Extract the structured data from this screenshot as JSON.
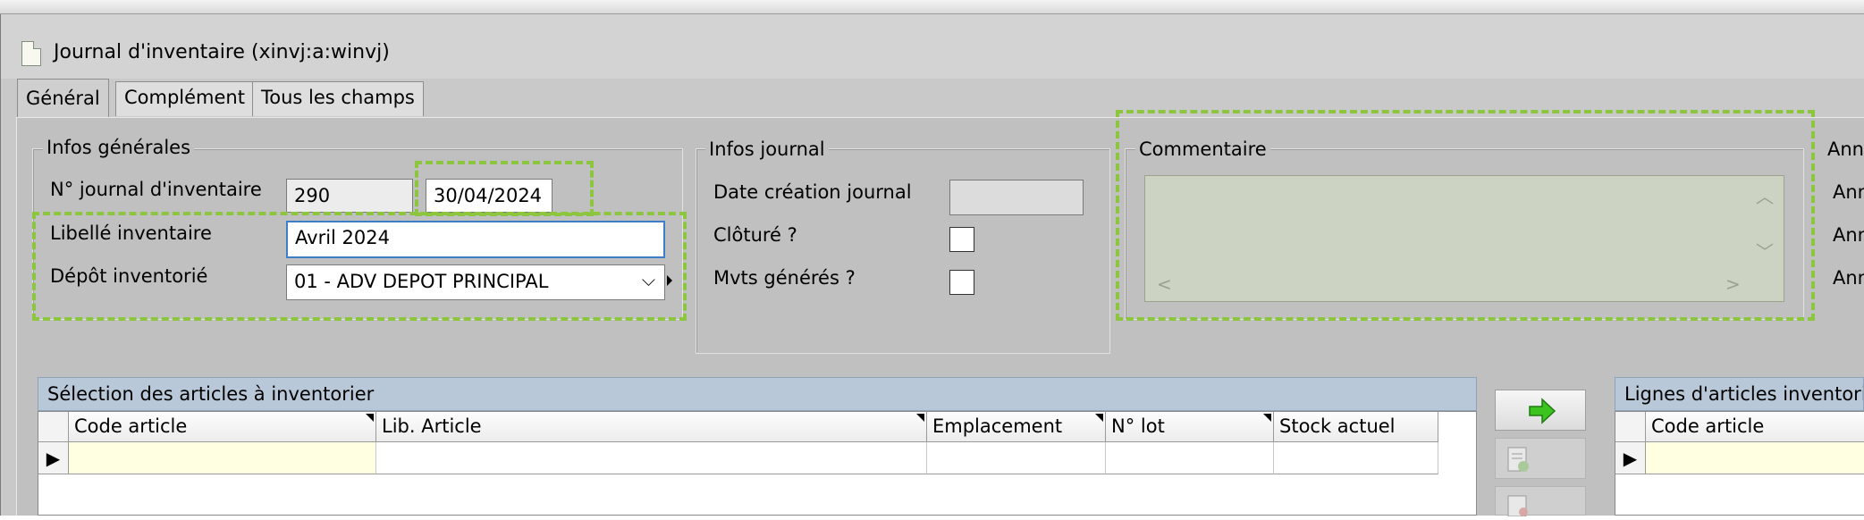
{
  "window": {
    "title": "Journal d'inventaire (xinvj:a:winvj)",
    "icon": "document-icon"
  },
  "tabs": [
    {
      "label": "Général",
      "active": true
    },
    {
      "label": "Complément",
      "active": false
    },
    {
      "label": "Tous les champs",
      "active": false
    }
  ],
  "infos_generales": {
    "title": "Infos générales",
    "journal_number": {
      "label": "N° journal d'inventaire",
      "value": "290",
      "date": "30/04/2024"
    },
    "libelle": {
      "label": "Libellé inventaire",
      "value": "Avril 2024"
    },
    "depot": {
      "label": "Dépôt inventorié",
      "value": "01 - ADV DEPOT PRINCIPAL"
    }
  },
  "infos_journal": {
    "title": "Infos journal",
    "date_creation": {
      "label": "Date création journal",
      "value": ""
    },
    "cloture": {
      "label": "Clôturé ?",
      "checked": false
    },
    "mvts": {
      "label": "Mvts générés ?",
      "checked": false
    }
  },
  "commentaire": {
    "title": "Commentaire",
    "value": ""
  },
  "annexe": {
    "title": "Ann",
    "items": [
      "Ann",
      "Ann",
      "Ann"
    ]
  },
  "selection": {
    "title": "Sélection des articles à inventorier",
    "columns": [
      "Code article",
      "Lib. Article",
      "Emplacement",
      "N° lot",
      "Stock actuel"
    ],
    "row_indicator": "▶"
  },
  "lignes": {
    "title": "Lignes d'articles inventoriés",
    "columns": [
      "Code article"
    ],
    "row_indicator": "▶"
  },
  "icons": {
    "transfer": "green-arrow-right-icon",
    "validate_doc": "document-check-icon",
    "remove_doc": "document-remove-icon"
  },
  "colors": {
    "highlight_dash": "#8cc63e",
    "header_blue": "#b9c8d8",
    "row_yellow": "#ffffe1",
    "focus_border": "#3a7fc8",
    "arrow_green": "#3cc31f"
  }
}
